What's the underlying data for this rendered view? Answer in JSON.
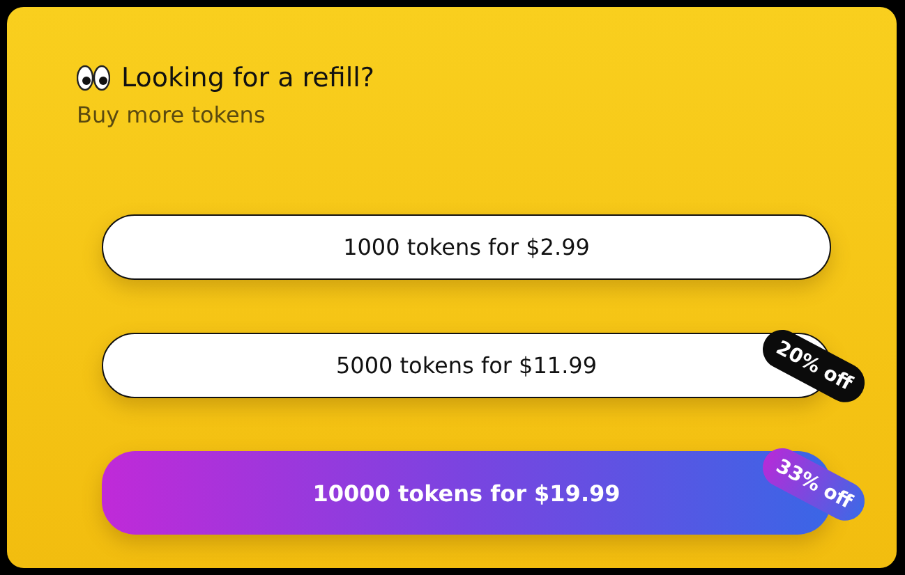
{
  "title": "Looking for a refill?",
  "subtitle": "Buy more tokens",
  "offers": [
    {
      "label": "1000 tokens for $2.99",
      "kind": "plain"
    },
    {
      "label": "5000 tokens for $11.99",
      "kind": "plain",
      "badge": {
        "text": "20% off",
        "kind": "dark"
      }
    },
    {
      "label": "10000 tokens for $19.99",
      "kind": "featured",
      "badge": {
        "text": "33% off",
        "kind": "gradient"
      }
    }
  ]
}
